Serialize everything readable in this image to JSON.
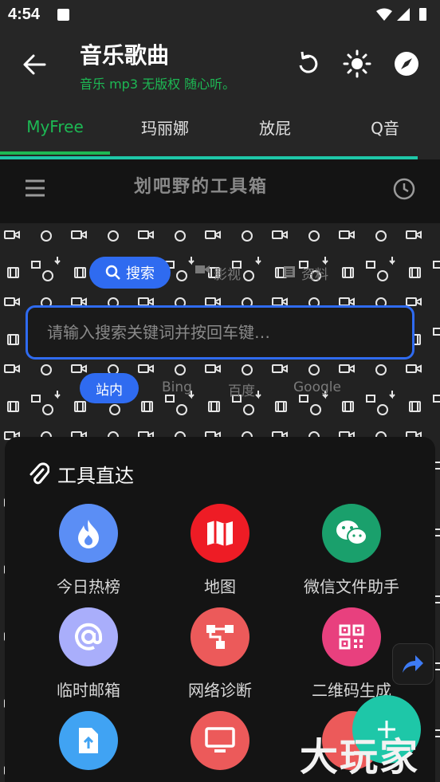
{
  "status_bar": {
    "time": "4:54"
  },
  "app_bar": {
    "title": "音乐歌曲",
    "subtitle": "音乐 mp3 无版权 随心听。",
    "actions": [
      "refresh-icon",
      "brightness-icon",
      "compass-icon"
    ]
  },
  "tabs": [
    {
      "label": "MyFree",
      "active": true
    },
    {
      "label": "玛丽娜",
      "active": false
    },
    {
      "label": "放屁",
      "active": false
    },
    {
      "label": "Q音",
      "active": false
    }
  ],
  "web": {
    "site_title": "划吧野的工具箱",
    "search_tabs": [
      "搜索",
      "影视",
      "资料"
    ],
    "search_placeholder": "请输入搜索关键词并按回车键…",
    "engines": [
      "站内",
      "Bing",
      "百度",
      "Google"
    ]
  },
  "sheet": {
    "title": "工具直达",
    "tools": [
      {
        "label": "今日热榜",
        "icon": "flame-icon",
        "color": "#5b8ef5"
      },
      {
        "label": "地图",
        "icon": "map-icon",
        "color": "#ee1c25"
      },
      {
        "label": "微信文件助手",
        "icon": "wechat-icon",
        "color": "#1aa06c"
      },
      {
        "label": "临时邮箱",
        "icon": "at-icon",
        "color": "#a9aefb"
      },
      {
        "label": "网络诊断",
        "icon": "network-icon",
        "color": "#ec5a5a"
      },
      {
        "label": "二维码生成",
        "icon": "qrcode-icon",
        "color": "#e8407e"
      },
      {
        "label": "",
        "icon": "file-upload-icon",
        "color": "#40a3f3"
      },
      {
        "label": "",
        "icon": "monitor-icon",
        "color": "#ec5a5a"
      },
      {
        "label": "",
        "icon": "unknown-icon",
        "color": "#ec5a5a"
      }
    ]
  },
  "watermark": "大玩家",
  "colors": {
    "accent": "#1db954",
    "teal": "#1ec7a8",
    "blue": "#2f6bf0"
  }
}
